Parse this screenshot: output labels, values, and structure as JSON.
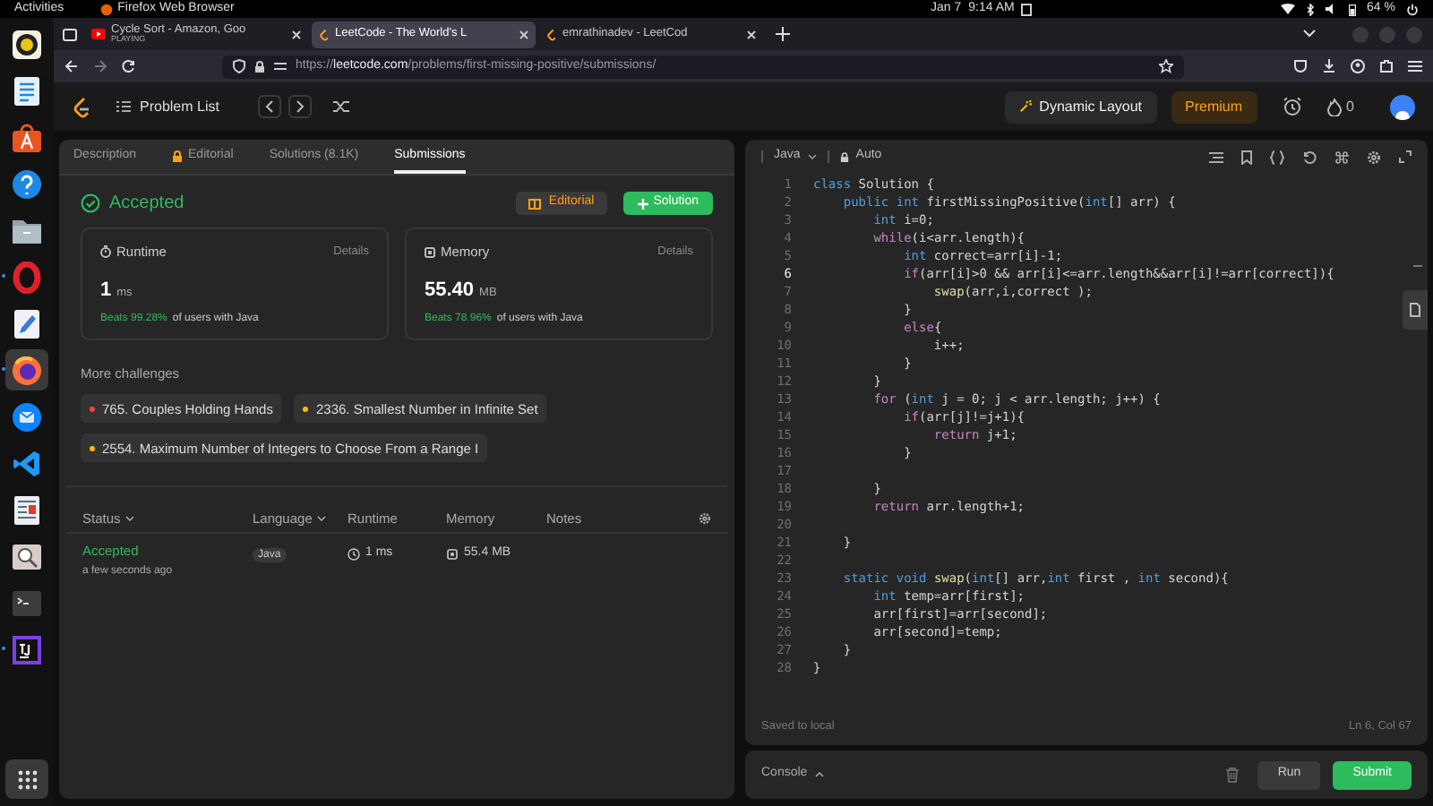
{
  "top_bar": {
    "activities": "Activities",
    "app": "Firefox Web Browser",
    "date": "Jan 7",
    "time": "9:14 AM",
    "battery": "64 %"
  },
  "dock": {
    "apps": [
      {
        "running": false,
        "selected": false
      },
      {
        "running": false,
        "selected": false
      },
      {
        "running": false,
        "selected": false
      },
      {
        "running": false,
        "selected": false
      },
      {
        "running": false,
        "selected": false
      },
      {
        "running": true,
        "selected": false
      },
      {
        "running": false,
        "selected": false
      },
      {
        "running": true,
        "selected": true
      },
      {
        "running": false,
        "selected": false
      },
      {
        "running": false,
        "selected": false
      },
      {
        "running": false,
        "selected": false
      },
      {
        "running": false,
        "selected": false
      },
      {
        "running": false,
        "selected": false
      },
      {
        "running": true,
        "selected": false
      }
    ]
  },
  "browser": {
    "tabs": [
      {
        "title": "Cycle Sort - Amazon, Goo",
        "subtitle": "PLAYING",
        "selected": false
      },
      {
        "title": "LeetCode - The World's L",
        "selected": true
      },
      {
        "title": "emrathinadev - LeetCod",
        "selected": false
      }
    ],
    "url": {
      "scheme": "https://",
      "host": "leetcode.com",
      "path": "/problems/first-missing-positive/submissions/"
    }
  },
  "header": {
    "problem_list": "Problem List",
    "dynamic_layout": "Dynamic Layout",
    "premium": "Premium",
    "streak": "0"
  },
  "left": {
    "tabs": [
      {
        "label": "Description",
        "selected": false,
        "locked": false
      },
      {
        "label": "Editorial",
        "selected": false,
        "locked": true
      },
      {
        "label": "Solutions (8.1K)",
        "selected": false,
        "locked": false
      },
      {
        "label": "Submissions",
        "selected": true,
        "locked": false
      }
    ],
    "result": {
      "status": "Accepted",
      "editorial_button": "Editorial",
      "solution_button": "Solution"
    },
    "stats": [
      {
        "kind": "runtime",
        "title": "Runtime",
        "details": "Details",
        "value": "1",
        "unit": "ms",
        "beats": "Beats 99.28%",
        "beats_rest": "of users with Java"
      },
      {
        "kind": "memory",
        "title": "Memory",
        "details": "Details",
        "value": "55.40",
        "unit": "MB",
        "beats": "Beats 78.96%",
        "beats_rest": "of users with Java"
      }
    ],
    "more_challenges": {
      "title": "More challenges",
      "items": [
        {
          "label": "765. Couples Holding Hands",
          "color": "#ef4743"
        },
        {
          "label": "2336. Smallest Number in Infinite Set",
          "color": "#ffb800"
        },
        {
          "label": "2554. Maximum Number of Integers to Choose From a Range I",
          "color": "#ffb800"
        }
      ]
    },
    "submissions": {
      "columns": [
        {
          "label": "Status",
          "sortable": true
        },
        {
          "label": "Language",
          "sortable": true
        },
        {
          "label": "Runtime",
          "sortable": false
        },
        {
          "label": "Memory",
          "sortable": false
        },
        {
          "label": "Notes",
          "sortable": false
        }
      ],
      "rows": [
        {
          "status": "Accepted",
          "time": "a few seconds ago",
          "language": "Java",
          "runtime": "1 ms",
          "memory": "55.4 MB"
        }
      ]
    }
  },
  "editor": {
    "language": "Java",
    "mode": "Auto",
    "status": "Saved to local",
    "cursor": "Ln 6, Col 67",
    "lines": [
      {
        "number": "1",
        "active": false,
        "tokens": [
          {
            "text": "class",
            "kind": "type"
          },
          {
            "text": " Solution {",
            "kind": "plain"
          }
        ]
      },
      {
        "number": "2",
        "active": false,
        "tokens": [
          {
            "text": "    public int",
            "kind": "type"
          },
          {
            "text": " firstMissingPositive(",
            "kind": "plain"
          },
          {
            "text": "int",
            "kind": "type"
          },
          {
            "text": "[] arr) {",
            "kind": "plain"
          }
        ]
      },
      {
        "number": "3",
        "active": false,
        "tokens": [
          {
            "text": "        int",
            "kind": "type"
          },
          {
            "text": " i=0;",
            "kind": "plain"
          }
        ]
      },
      {
        "number": "4",
        "active": false,
        "tokens": [
          {
            "text": "        while",
            "kind": "control"
          },
          {
            "text": "(i<arr.length){",
            "kind": "plain"
          }
        ]
      },
      {
        "number": "5",
        "active": false,
        "tokens": [
          {
            "text": "            int",
            "kind": "type"
          },
          {
            "text": " correct=arr[i]-1;",
            "kind": "plain"
          }
        ]
      },
      {
        "number": "6",
        "active": true,
        "tokens": [
          {
            "text": "            if",
            "kind": "control"
          },
          {
            "text": "(arr[i]>0 && arr[i]<=arr.length&&arr[i]!=arr[correct]){",
            "kind": "plain"
          }
        ]
      },
      {
        "number": "7",
        "active": false,
        "tokens": [
          {
            "text": "                swap",
            "kind": "function"
          },
          {
            "text": "(arr,i,correct );",
            "kind": "plain"
          }
        ]
      },
      {
        "number": "8",
        "active": false,
        "tokens": [
          {
            "text": "            }",
            "kind": "plain"
          }
        ]
      },
      {
        "number": "9",
        "active": false,
        "tokens": [
          {
            "text": "            else",
            "kind": "control"
          },
          {
            "text": "{",
            "kind": "plain"
          }
        ]
      },
      {
        "number": "10",
        "active": false,
        "tokens": [
          {
            "text": "                i++;",
            "kind": "plain"
          }
        ]
      },
      {
        "number": "11",
        "active": false,
        "tokens": [
          {
            "text": "            }",
            "kind": "plain"
          }
        ]
      },
      {
        "number": "12",
        "active": false,
        "tokens": [
          {
            "text": "        }",
            "kind": "plain"
          }
        ]
      },
      {
        "number": "13",
        "active": false,
        "tokens": [
          {
            "text": "        for",
            "kind": "control"
          },
          {
            "text": " (",
            "kind": "plain"
          },
          {
            "text": "int",
            "kind": "type"
          },
          {
            "text": " j = 0; j < arr.length; j++) {",
            "kind": "plain"
          }
        ]
      },
      {
        "number": "14",
        "active": false,
        "tokens": [
          {
            "text": "            if",
            "kind": "control"
          },
          {
            "text": "(arr[j]!=j+1){",
            "kind": "plain"
          }
        ]
      },
      {
        "number": "15",
        "active": false,
        "tokens": [
          {
            "text": "                return",
            "kind": "control"
          },
          {
            "text": " j+1;",
            "kind": "plain"
          }
        ]
      },
      {
        "number": "16",
        "active": false,
        "tokens": [
          {
            "text": "            }",
            "kind": "plain"
          }
        ]
      },
      {
        "number": "17",
        "active": false
      },
      {
        "number": "18",
        "active": false,
        "tokens": [
          {
            "text": "        }",
            "kind": "plain"
          }
        ]
      },
      {
        "number": "19",
        "active": false,
        "tokens": [
          {
            "text": "        return",
            "kind": "control"
          },
          {
            "text": " arr.length+1;",
            "kind": "plain"
          }
        ]
      },
      {
        "number": "20",
        "active": false
      },
      {
        "number": "21",
        "active": false,
        "tokens": [
          {
            "text": "    }",
            "kind": "plain"
          }
        ]
      },
      {
        "number": "22",
        "active": false
      },
      {
        "number": "23",
        "active": false,
        "tokens": [
          {
            "text": "    static void ",
            "kind": "type"
          },
          {
            "text": "swap",
            "kind": "function"
          },
          {
            "text": "(",
            "kind": "plain"
          },
          {
            "text": "int",
            "kind": "type"
          },
          {
            "text": "[] arr,",
            "kind": "plain"
          },
          {
            "text": "int",
            "kind": "type"
          },
          {
            "text": " first , ",
            "kind": "plain"
          },
          {
            "text": "int",
            "kind": "type"
          },
          {
            "text": " second){",
            "kind": "plain"
          }
        ]
      },
      {
        "number": "24",
        "active": false,
        "tokens": [
          {
            "text": "        int",
            "kind": "type"
          },
          {
            "text": " temp=arr[first];",
            "kind": "plain"
          }
        ]
      },
      {
        "number": "25",
        "active": false,
        "tokens": [
          {
            "text": "        arr[first]=arr[second];",
            "kind": "plain"
          }
        ]
      },
      {
        "number": "26",
        "active": false,
        "tokens": [
          {
            "text": "        arr[second]=temp;",
            "kind": "plain"
          }
        ]
      },
      {
        "number": "27",
        "active": false,
        "tokens": [
          {
            "text": "    }",
            "kind": "plain"
          }
        ]
      },
      {
        "number": "28",
        "active": false,
        "tokens": [
          {
            "text": "}",
            "kind": "plain"
          }
        ]
      }
    ]
  },
  "console": {
    "label": "Console",
    "run": "Run",
    "submit": "Submit"
  }
}
